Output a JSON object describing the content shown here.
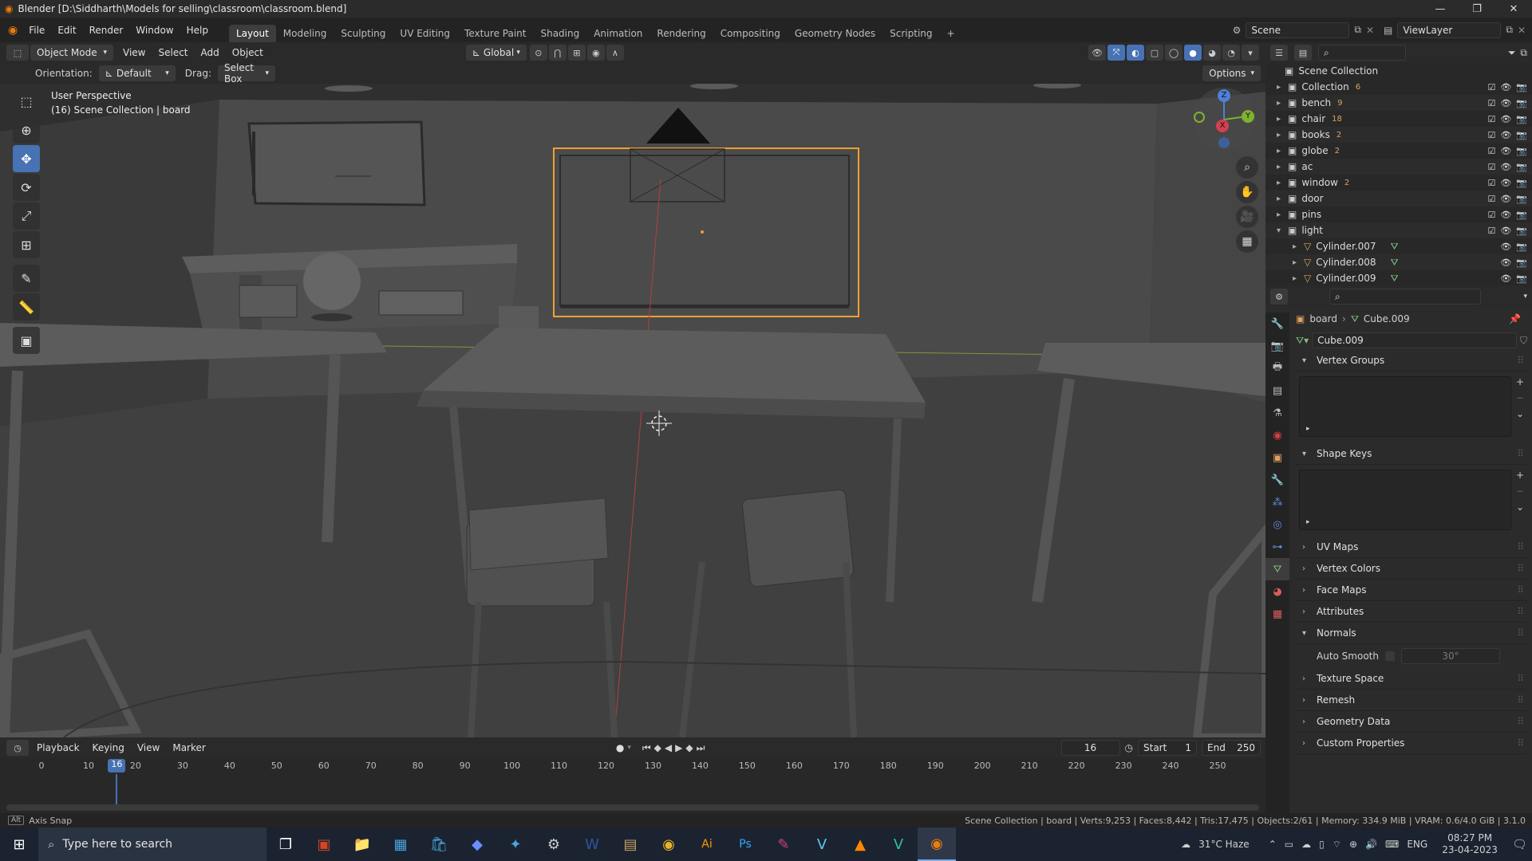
{
  "window": {
    "title": "Blender [D:\\Siddharth\\Models for selling\\classroom\\classroom.blend]",
    "min": "—",
    "max": "❐",
    "close": "✕"
  },
  "menu": [
    "File",
    "Edit",
    "Render",
    "Window",
    "Help"
  ],
  "workspaces": [
    "Layout",
    "Modeling",
    "Sculpting",
    "UV Editing",
    "Texture Paint",
    "Shading",
    "Animation",
    "Rendering",
    "Compositing",
    "Geometry Nodes",
    "Scripting",
    "+"
  ],
  "active_workspace": "Layout",
  "scene": {
    "name": "Scene",
    "view_layer": "ViewLayer"
  },
  "viewport_header": {
    "mode": "Object Mode",
    "menus": [
      "View",
      "Select",
      "Add",
      "Object"
    ],
    "transform": "Global"
  },
  "tool_settings": {
    "orientation_label": "Orientation:",
    "orientation_value": "Default",
    "drag_label": "Drag:",
    "drag_value": "Select Box",
    "options": "Options"
  },
  "viewport": {
    "perspective": "User Perspective",
    "collection_info": "(16) Scene Collection | board"
  },
  "gizmo": {
    "z": "Z",
    "y": "Y",
    "x": "X"
  },
  "tools": [
    {
      "name": "select-box-tool",
      "glyph": "⬚"
    },
    {
      "name": "cursor-tool",
      "glyph": "⊕"
    },
    {
      "name": "move-tool",
      "glyph": "✥"
    },
    {
      "name": "rotate-tool",
      "glyph": "⟳"
    },
    {
      "name": "scale-tool",
      "glyph": "⤢"
    },
    {
      "name": "transform-tool",
      "glyph": "⊞"
    },
    {
      "name": "annotate-tool",
      "glyph": "✎"
    },
    {
      "name": "measure-tool",
      "glyph": "📏"
    },
    {
      "name": "add-cube-tool",
      "glyph": "▣"
    }
  ],
  "outliner": {
    "root": "Scene Collection",
    "items": [
      {
        "label": "Collection",
        "badge": "6",
        "indent": 0,
        "expanded": false
      },
      {
        "label": "bench",
        "badge": "9",
        "indent": 0,
        "expanded": false
      },
      {
        "label": "chair",
        "badge": "18",
        "indent": 0,
        "expanded": false
      },
      {
        "label": "books",
        "badge": "2",
        "indent": 0,
        "expanded": false
      },
      {
        "label": "globe",
        "badge": "2",
        "indent": 0,
        "expanded": false
      },
      {
        "label": "ac",
        "badge": "",
        "indent": 0,
        "expanded": false
      },
      {
        "label": "window",
        "badge": "2",
        "indent": 0,
        "expanded": false
      },
      {
        "label": "door",
        "badge": "",
        "indent": 0,
        "expanded": false
      },
      {
        "label": "pins",
        "badge": "",
        "indent": 0,
        "expanded": false
      },
      {
        "label": "light",
        "badge": "",
        "indent": 0,
        "expanded": true
      },
      {
        "label": "Cylinder.007",
        "badge": "",
        "indent": 1,
        "expanded": false
      },
      {
        "label": "Cylinder.008",
        "badge": "",
        "indent": 1,
        "expanded": false
      },
      {
        "label": "Cylinder.009",
        "badge": "",
        "indent": 1,
        "expanded": false
      }
    ]
  },
  "properties": {
    "breadcrumb_object": "board",
    "breadcrumb_data": "Cube.009",
    "mesh_name": "Cube.009",
    "panels": [
      {
        "label": "Vertex Groups",
        "open": true
      },
      {
        "label": "Shape Keys",
        "open": true
      },
      {
        "label": "UV Maps",
        "open": false
      },
      {
        "label": "Vertex Colors",
        "open": false
      },
      {
        "label": "Face Maps",
        "open": false
      },
      {
        "label": "Attributes",
        "open": false
      },
      {
        "label": "Normals",
        "open": true
      },
      {
        "label": "Texture Space",
        "open": false
      },
      {
        "label": "Remesh",
        "open": false
      },
      {
        "label": "Geometry Data",
        "open": false
      },
      {
        "label": "Custom Properties",
        "open": false
      }
    ],
    "auto_smooth_label": "Auto Smooth",
    "auto_smooth_angle": "30°"
  },
  "timeline": {
    "menus": [
      "Playback",
      "Keying",
      "View",
      "Marker"
    ],
    "current_frame": "16",
    "start_label": "Start",
    "start": "1",
    "end_label": "End",
    "end": "250",
    "ticks": [
      "0",
      "10",
      "20",
      "30",
      "40",
      "50",
      "60",
      "70",
      "80",
      "90",
      "100",
      "110",
      "120",
      "130",
      "140",
      "150",
      "160",
      "170",
      "180",
      "190",
      "200",
      "210",
      "220",
      "230",
      "240",
      "250"
    ],
    "playhead": 16
  },
  "status": {
    "left": "Axis Snap",
    "right": "Scene Collection | board | Verts:9,253 | Faces:8,442 | Tris:17,475 | Objects:2/61 | Memory: 334.9 MiB | VRAM: 0.6/4.0 GiB | 3.1.0"
  },
  "taskbar": {
    "search_placeholder": "Type here to search",
    "weather": "31°C  Haze",
    "lang": "ENG",
    "time": "08:27 PM",
    "date": "23-04-2023"
  },
  "colors": {
    "accent": "#4772b3",
    "selection": "#f0a030",
    "viewport_bg": "#3e3e3e"
  }
}
